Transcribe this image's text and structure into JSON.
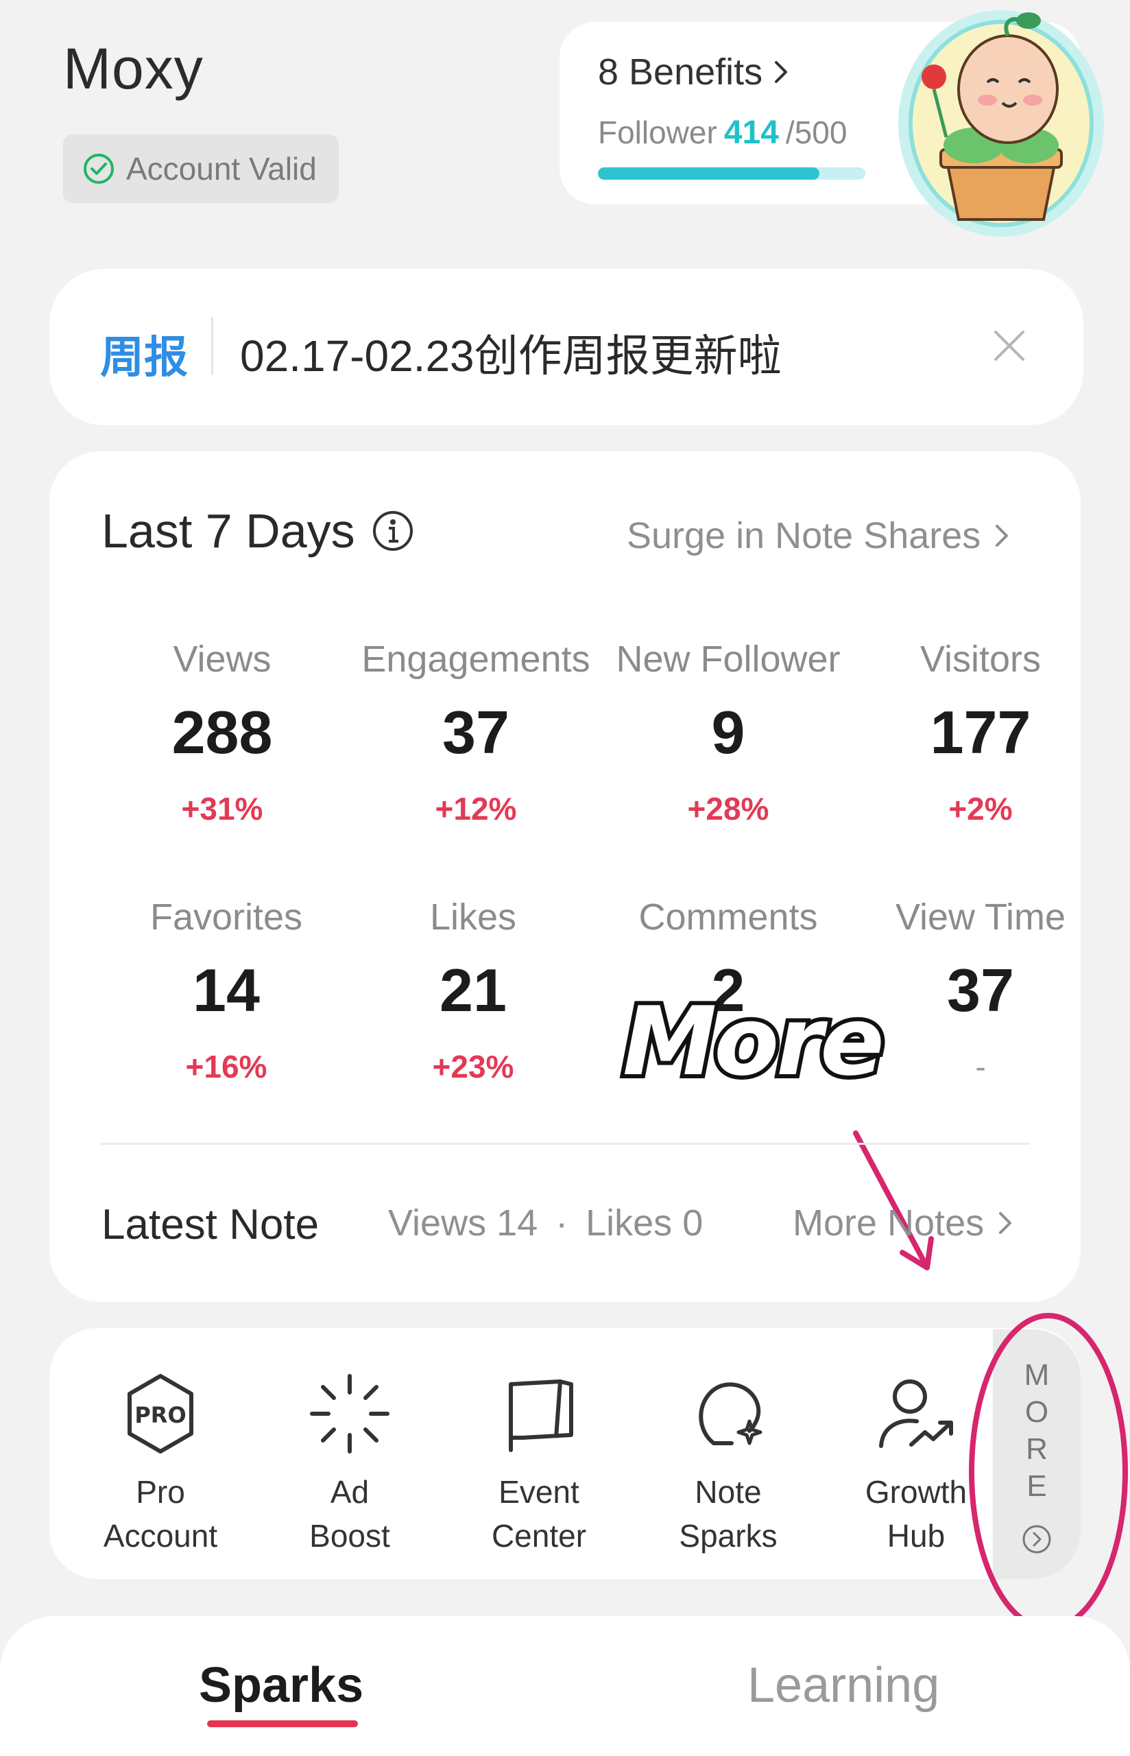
{
  "header": {
    "username": "Moxy",
    "account_status": "Account Valid"
  },
  "benefits": {
    "title": "8 Benefits",
    "follower_label": "Follower",
    "follower_count": "414",
    "follower_goal": "/500",
    "progress_fraction": 0.828
  },
  "banner": {
    "tag": "周报",
    "text": "02.17-02.23创作周报更新啦"
  },
  "stats": {
    "title": "Last 7 Days",
    "surge_link": "Surge in Note Shares",
    "metrics": [
      {
        "label": "Views",
        "value": "288",
        "change": "+31%"
      },
      {
        "label": "Engagements",
        "value": "37",
        "change": "+12%"
      },
      {
        "label": "New Follower",
        "value": "9",
        "change": "+28%"
      },
      {
        "label": "Visitors",
        "value": "177",
        "change": "+2%"
      },
      {
        "label": "Favorites",
        "value": "14",
        "change": "+16%"
      },
      {
        "label": "Likes",
        "value": "21",
        "change": "+23%"
      },
      {
        "label": "Comments",
        "value": "2",
        "change": ""
      },
      {
        "label": "View Time",
        "value": "37",
        "change": "-"
      }
    ],
    "latest_note": {
      "title": "Latest Note",
      "views": "Views 14",
      "dot": "·",
      "likes": "Likes 0",
      "more_link": "More Notes"
    }
  },
  "overlay": {
    "text": "More"
  },
  "tools": [
    {
      "line1": "Pro",
      "line2": "Account",
      "icon": "pro-icon"
    },
    {
      "line1": "Ad",
      "line2": "Boost",
      "icon": "sparkle-burst-icon"
    },
    {
      "line1": "Event",
      "line2": "Center",
      "icon": "flag-icon"
    },
    {
      "line1": "Note",
      "line2": "Sparks",
      "icon": "lightbulb-icon"
    },
    {
      "line1": "Growth",
      "line2": "Hub",
      "icon": "person-growth-icon"
    }
  ],
  "more_panel": {
    "letters": [
      "M",
      "O",
      "R",
      "E"
    ]
  },
  "tabs": {
    "active": "Sparks",
    "inactive": "Learning"
  },
  "colors": {
    "accent_red": "#e5344f",
    "teal": "#2ec4cf",
    "blue_tag": "#2f8de4",
    "change_red": "#e23a55",
    "annotation_pink": "#d6266e"
  }
}
